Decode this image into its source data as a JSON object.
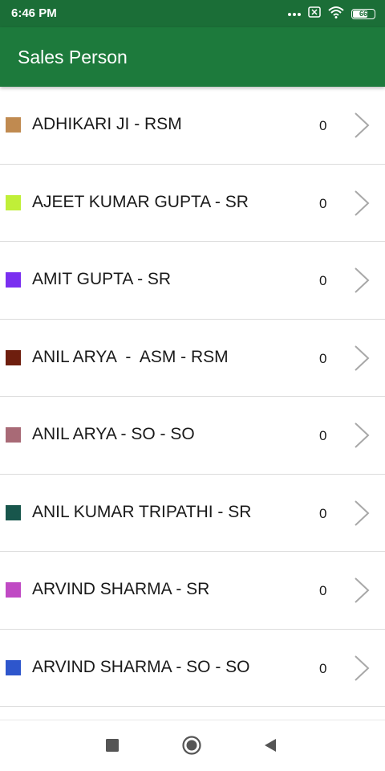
{
  "status_bar": {
    "time": "6:46 PM",
    "battery_level": "66",
    "icons": [
      "more-dots-icon",
      "close-box-icon",
      "wifi-icon",
      "battery-icon"
    ]
  },
  "app_bar": {
    "title": "Sales Person"
  },
  "sales_persons": [
    {
      "name": "ADHIKARI JI - RSM",
      "count": "0",
      "color": "#c08a50"
    },
    {
      "name": "AJEET KUMAR GUPTA - SR",
      "count": "0",
      "color": "#c0ef38"
    },
    {
      "name": "AMIT GUPTA - SR",
      "count": "0",
      "color": "#7a2ff0"
    },
    {
      "name": "ANIL ARYA  -  ASM - RSM",
      "count": "0",
      "color": "#6e1e0e"
    },
    {
      "name": "ANIL ARYA - SO - SO",
      "count": "0",
      "color": "#a86a76"
    },
    {
      "name": "ANIL KUMAR TRIPATHI - SR",
      "count": "0",
      "color": "#18564c"
    },
    {
      "name": "ARVIND SHARMA - SR",
      "count": "0",
      "color": "#c04ac4"
    },
    {
      "name": "ARVIND SHARMA - SO - SO",
      "count": "0",
      "color": "#2e56cc"
    }
  ],
  "nav_bar": {
    "icons": [
      "recents-square-icon",
      "home-circle-icon",
      "back-triangle-icon"
    ]
  },
  "colors": {
    "status_bar_bg": "#1b6e37",
    "app_bar_bg": "#1d7a3c",
    "divider": "#dcdcdc",
    "chevron": "#a8a8a8"
  }
}
